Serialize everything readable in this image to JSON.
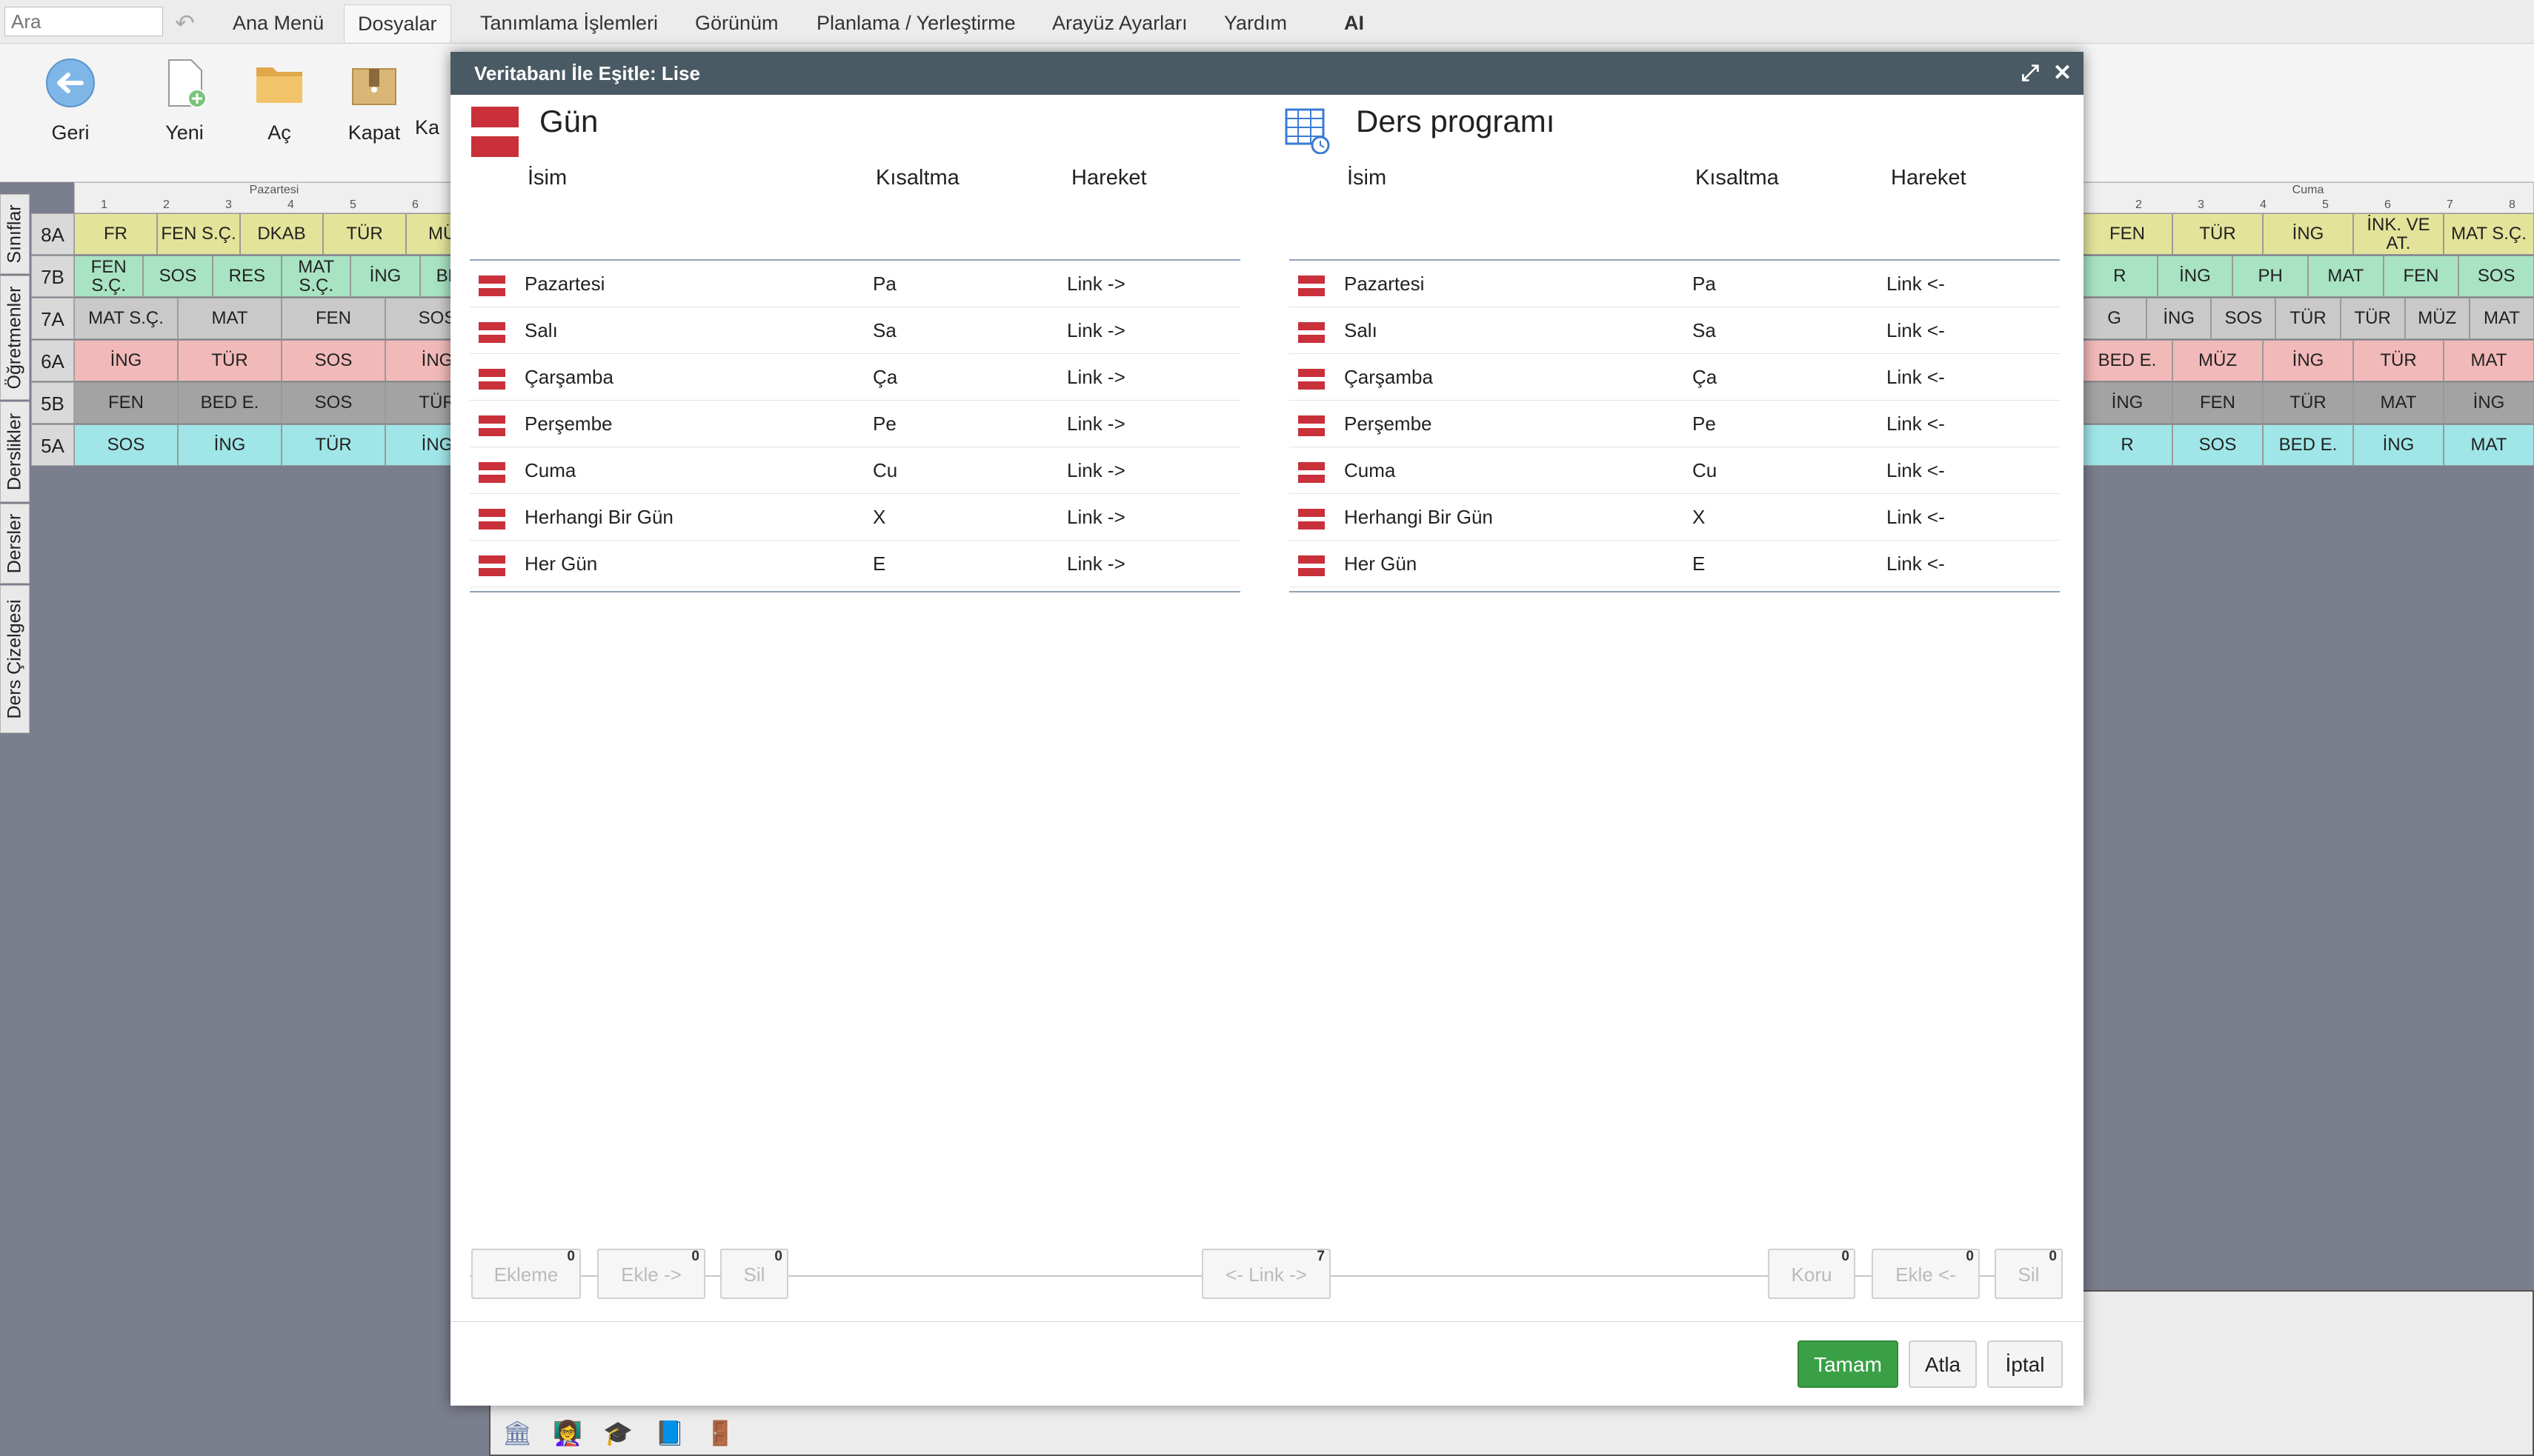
{
  "menubar": {
    "search_placeholder": "Ara",
    "items": [
      "Ana Menü",
      "Dosyalar",
      "Tanımlama İşlemleri",
      "Görünüm",
      "Planlama / Yerleştirme",
      "Arayüz Ayarları",
      "Yardım",
      "AI"
    ],
    "active": "Dosyalar"
  },
  "toolbar": {
    "back": "Geri",
    "new": "Yeni",
    "open": "Aç",
    "close": "Kapat",
    "partial": "Ka"
  },
  "side_tabs": [
    "Sınıflar",
    "Öğretmenler",
    "Derslikler",
    "Dersler",
    "Ders Çizelgesi"
  ],
  "timetable": {
    "day_left": "Pazartesi",
    "day_right": "Cuma",
    "periods": [
      "1",
      "2",
      "3",
      "4",
      "5",
      "6",
      "7",
      "8"
    ],
    "rows": [
      {
        "label": "8A",
        "color": "#e3e49a",
        "left": [
          "FR",
          "FEN S.Ç.",
          "DKAB",
          "TÜR",
          "MÜZ"
        ],
        "right": [
          "FEN",
          "TÜR",
          "İNG",
          "İNK. VE AT.",
          "MAT S.Ç."
        ]
      },
      {
        "label": "7B",
        "color": "#a8e3c4",
        "left": [
          "FEN S.Ç.",
          "SOS",
          "RES",
          "MAT S.Ç.",
          "İNG",
          "BED"
        ],
        "right": [
          "R",
          "İNG",
          "PH",
          "MAT",
          "FEN",
          "SOS"
        ]
      },
      {
        "label": "7A",
        "color": "#c9c9c9",
        "left": [
          "MAT S.Ç.",
          "MAT",
          "FEN",
          "SOS"
        ],
        "right": [
          "G",
          "İNG",
          "SOS",
          "TÜR",
          "TÜR",
          "MÜZ",
          "MAT"
        ]
      },
      {
        "label": "6A",
        "color": "#f2b9b9",
        "left": [
          "İNG",
          "TÜR",
          "SOS",
          "İNG"
        ],
        "right": [
          "BED E.",
          "MÜZ",
          "İNG",
          "TÜR",
          "MAT"
        ]
      },
      {
        "label": "5B",
        "color": "#a3a3a3",
        "left": [
          "FEN",
          "BED E.",
          "SOS",
          "TÜR"
        ],
        "right": [
          "İNG",
          "FEN",
          "TÜR",
          "MAT",
          "İNG"
        ]
      },
      {
        "label": "5A",
        "color": "#a0e6e8",
        "left": [
          "SOS",
          "İNG",
          "TÜR",
          "İNG"
        ],
        "right": [
          "R",
          "SOS",
          "BED E.",
          "İNG",
          "MAT"
        ]
      }
    ]
  },
  "dialog": {
    "title": "Veritabanı İle Eşitle: Lise",
    "left": {
      "title": "Gün",
      "columns": [
        "İsim",
        "Kısaltma",
        "Hareket"
      ],
      "rows": [
        [
          "Pazartesi",
          "Pa",
          "Link ->"
        ],
        [
          "Salı",
          "Sa",
          "Link ->"
        ],
        [
          "Çarşamba",
          "Ça",
          "Link ->"
        ],
        [
          "Perşembe",
          "Pe",
          "Link ->"
        ],
        [
          "Cuma",
          "Cu",
          "Link ->"
        ],
        [
          "Herhangi Bir Gün",
          "X",
          "Link ->"
        ],
        [
          "Her Gün",
          "E",
          "Link ->"
        ]
      ]
    },
    "right": {
      "title": "Ders programı",
      "columns": [
        "İsim",
        "Kısaltma",
        "Hareket"
      ],
      "rows": [
        [
          "Pazartesi",
          "Pa",
          "Link <-"
        ],
        [
          "Salı",
          "Sa",
          "Link <-"
        ],
        [
          "Çarşamba",
          "Ça",
          "Link <-"
        ],
        [
          "Perşembe",
          "Pe",
          "Link <-"
        ],
        [
          "Cuma",
          "Cu",
          "Link <-"
        ],
        [
          "Herhangi Bir Gün",
          "X",
          "Link <-"
        ],
        [
          "Her Gün",
          "E",
          "Link <-"
        ]
      ]
    },
    "buttons": {
      "ekleme": {
        "label": "Ekleme",
        "count": "0"
      },
      "ekle_right": {
        "label": "Ekle ->",
        "count": "0"
      },
      "sil_left": {
        "label": "Sil",
        "count": "0"
      },
      "link": {
        "label": "<- Link ->",
        "count": "7"
      },
      "koru": {
        "label": "Koru",
        "count": "0"
      },
      "ekle_left": {
        "label": "Ekle <-",
        "count": "0"
      },
      "sil_right": {
        "label": "Sil",
        "count": "0"
      }
    },
    "actions": {
      "ok": "Tamam",
      "skip": "Atla",
      "cancel": "İptal"
    }
  },
  "colors": {
    "title_bar": "#4a5a64",
    "ok_button": "#3aa046",
    "flag_red": "#c9303a"
  },
  "icons": [
    "expand-icon",
    "close-icon",
    "back-arrow-icon",
    "new-file-icon",
    "folder-icon",
    "archive-icon",
    "bank-icon",
    "teacher-icon",
    "graduation-cap-icon",
    "book-icon",
    "door-icon"
  ]
}
